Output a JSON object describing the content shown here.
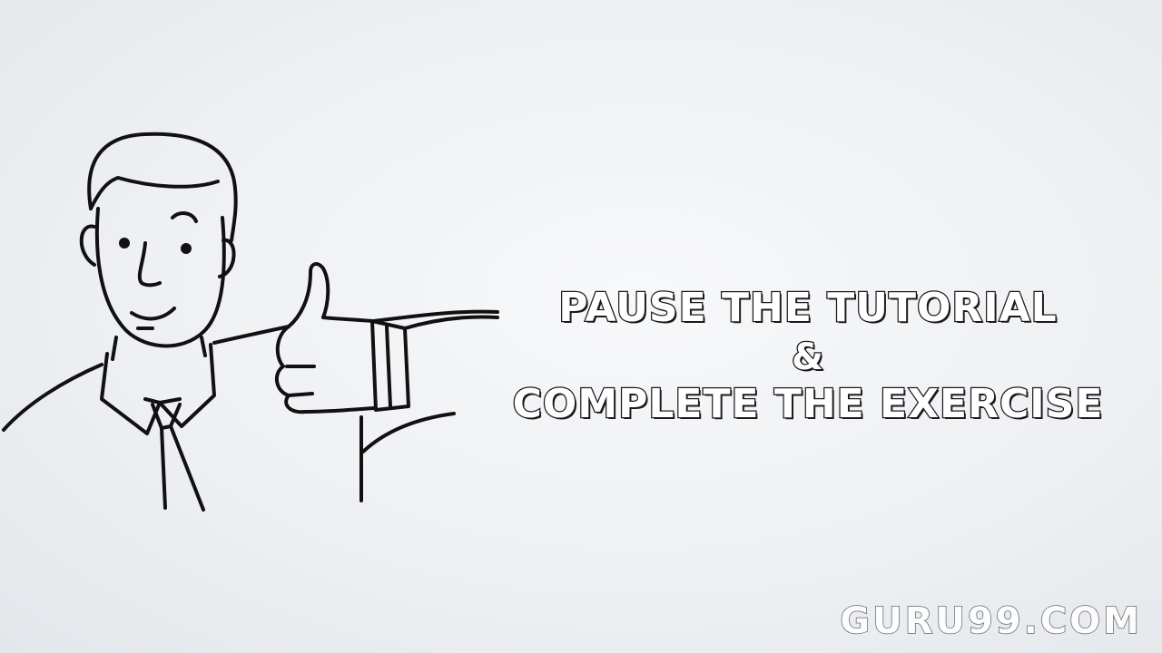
{
  "message": {
    "line1": "PAUSE THE TUTORIAL",
    "line2": "&",
    "line3": "COMPLETE THE EXERCISE"
  },
  "watermark": {
    "text": "GURU99.COM"
  },
  "illustration": {
    "subject": "man-giving-thumbs-up-icon"
  },
  "colors": {
    "background": "#eef0f3",
    "ink": "#1a1a1a",
    "text_fill": "#ffffff"
  }
}
